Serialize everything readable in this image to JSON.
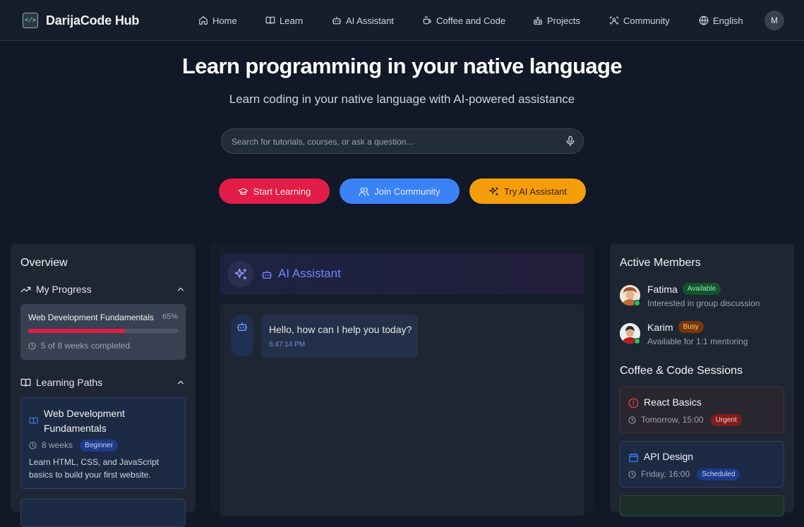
{
  "header": {
    "brand_name": "DarijaCode Hub",
    "nav": [
      {
        "label": "Home",
        "icon": "home-icon"
      },
      {
        "label": "Learn",
        "icon": "book-icon"
      },
      {
        "label": "AI Assistant",
        "icon": "bot-icon"
      },
      {
        "label": "Coffee and Code",
        "icon": "coffee-icon"
      },
      {
        "label": "Projects",
        "icon": "projects-icon"
      },
      {
        "label": "Community",
        "icon": "community-icon"
      },
      {
        "label": "English",
        "icon": "globe-icon"
      }
    ],
    "avatar_initial": "M"
  },
  "hero": {
    "title": "Learn programming in your native language",
    "subtitle": "Learn coding in your native language with AI-powered assistance",
    "search_placeholder": "Search for tutorials, courses, or ask a question...",
    "buttons": {
      "start_learning": "Start Learning",
      "join_community": "Join Community",
      "try_ai": "Try AI Assistant"
    }
  },
  "overview": {
    "title": "Overview",
    "progress_heading": "My Progress",
    "progress": {
      "course": "Web Development Fundamentals",
      "percent_label": "65%",
      "percent": 65,
      "weeks_label": "5 of 8 weeks completed"
    },
    "paths_heading": "Learning Paths",
    "path": {
      "title": "Web Development Fundamentals",
      "duration": "8 weeks",
      "level": "Beginner",
      "description": "Learn HTML, CSS, and JavaScript basics to build your first website."
    }
  },
  "assistant": {
    "title": "AI Assistant",
    "message": "Hello, how can I help you today?",
    "time": "6:47:14 PM"
  },
  "members": {
    "title": "Active Members",
    "list": [
      {
        "name": "Fatima",
        "badge": "Available",
        "status": "Interested in group discussion"
      },
      {
        "name": "Karim",
        "badge": "Busy",
        "status": "Available for 1:1 mentoring"
      }
    ]
  },
  "sessions": {
    "title": "Coffee & Code Sessions",
    "list": [
      {
        "title": "React Basics",
        "when": "Tomorrow, 15:00",
        "badge": "Urgent"
      },
      {
        "title": "API Design",
        "when": "Friday, 16:00",
        "badge": "Scheduled"
      }
    ]
  },
  "colors": {
    "background": "#111827",
    "accent_red": "#e11d48",
    "accent_blue": "#3b82f6",
    "accent_amber": "#f59e0b",
    "ai_title": "#6f86ff"
  }
}
